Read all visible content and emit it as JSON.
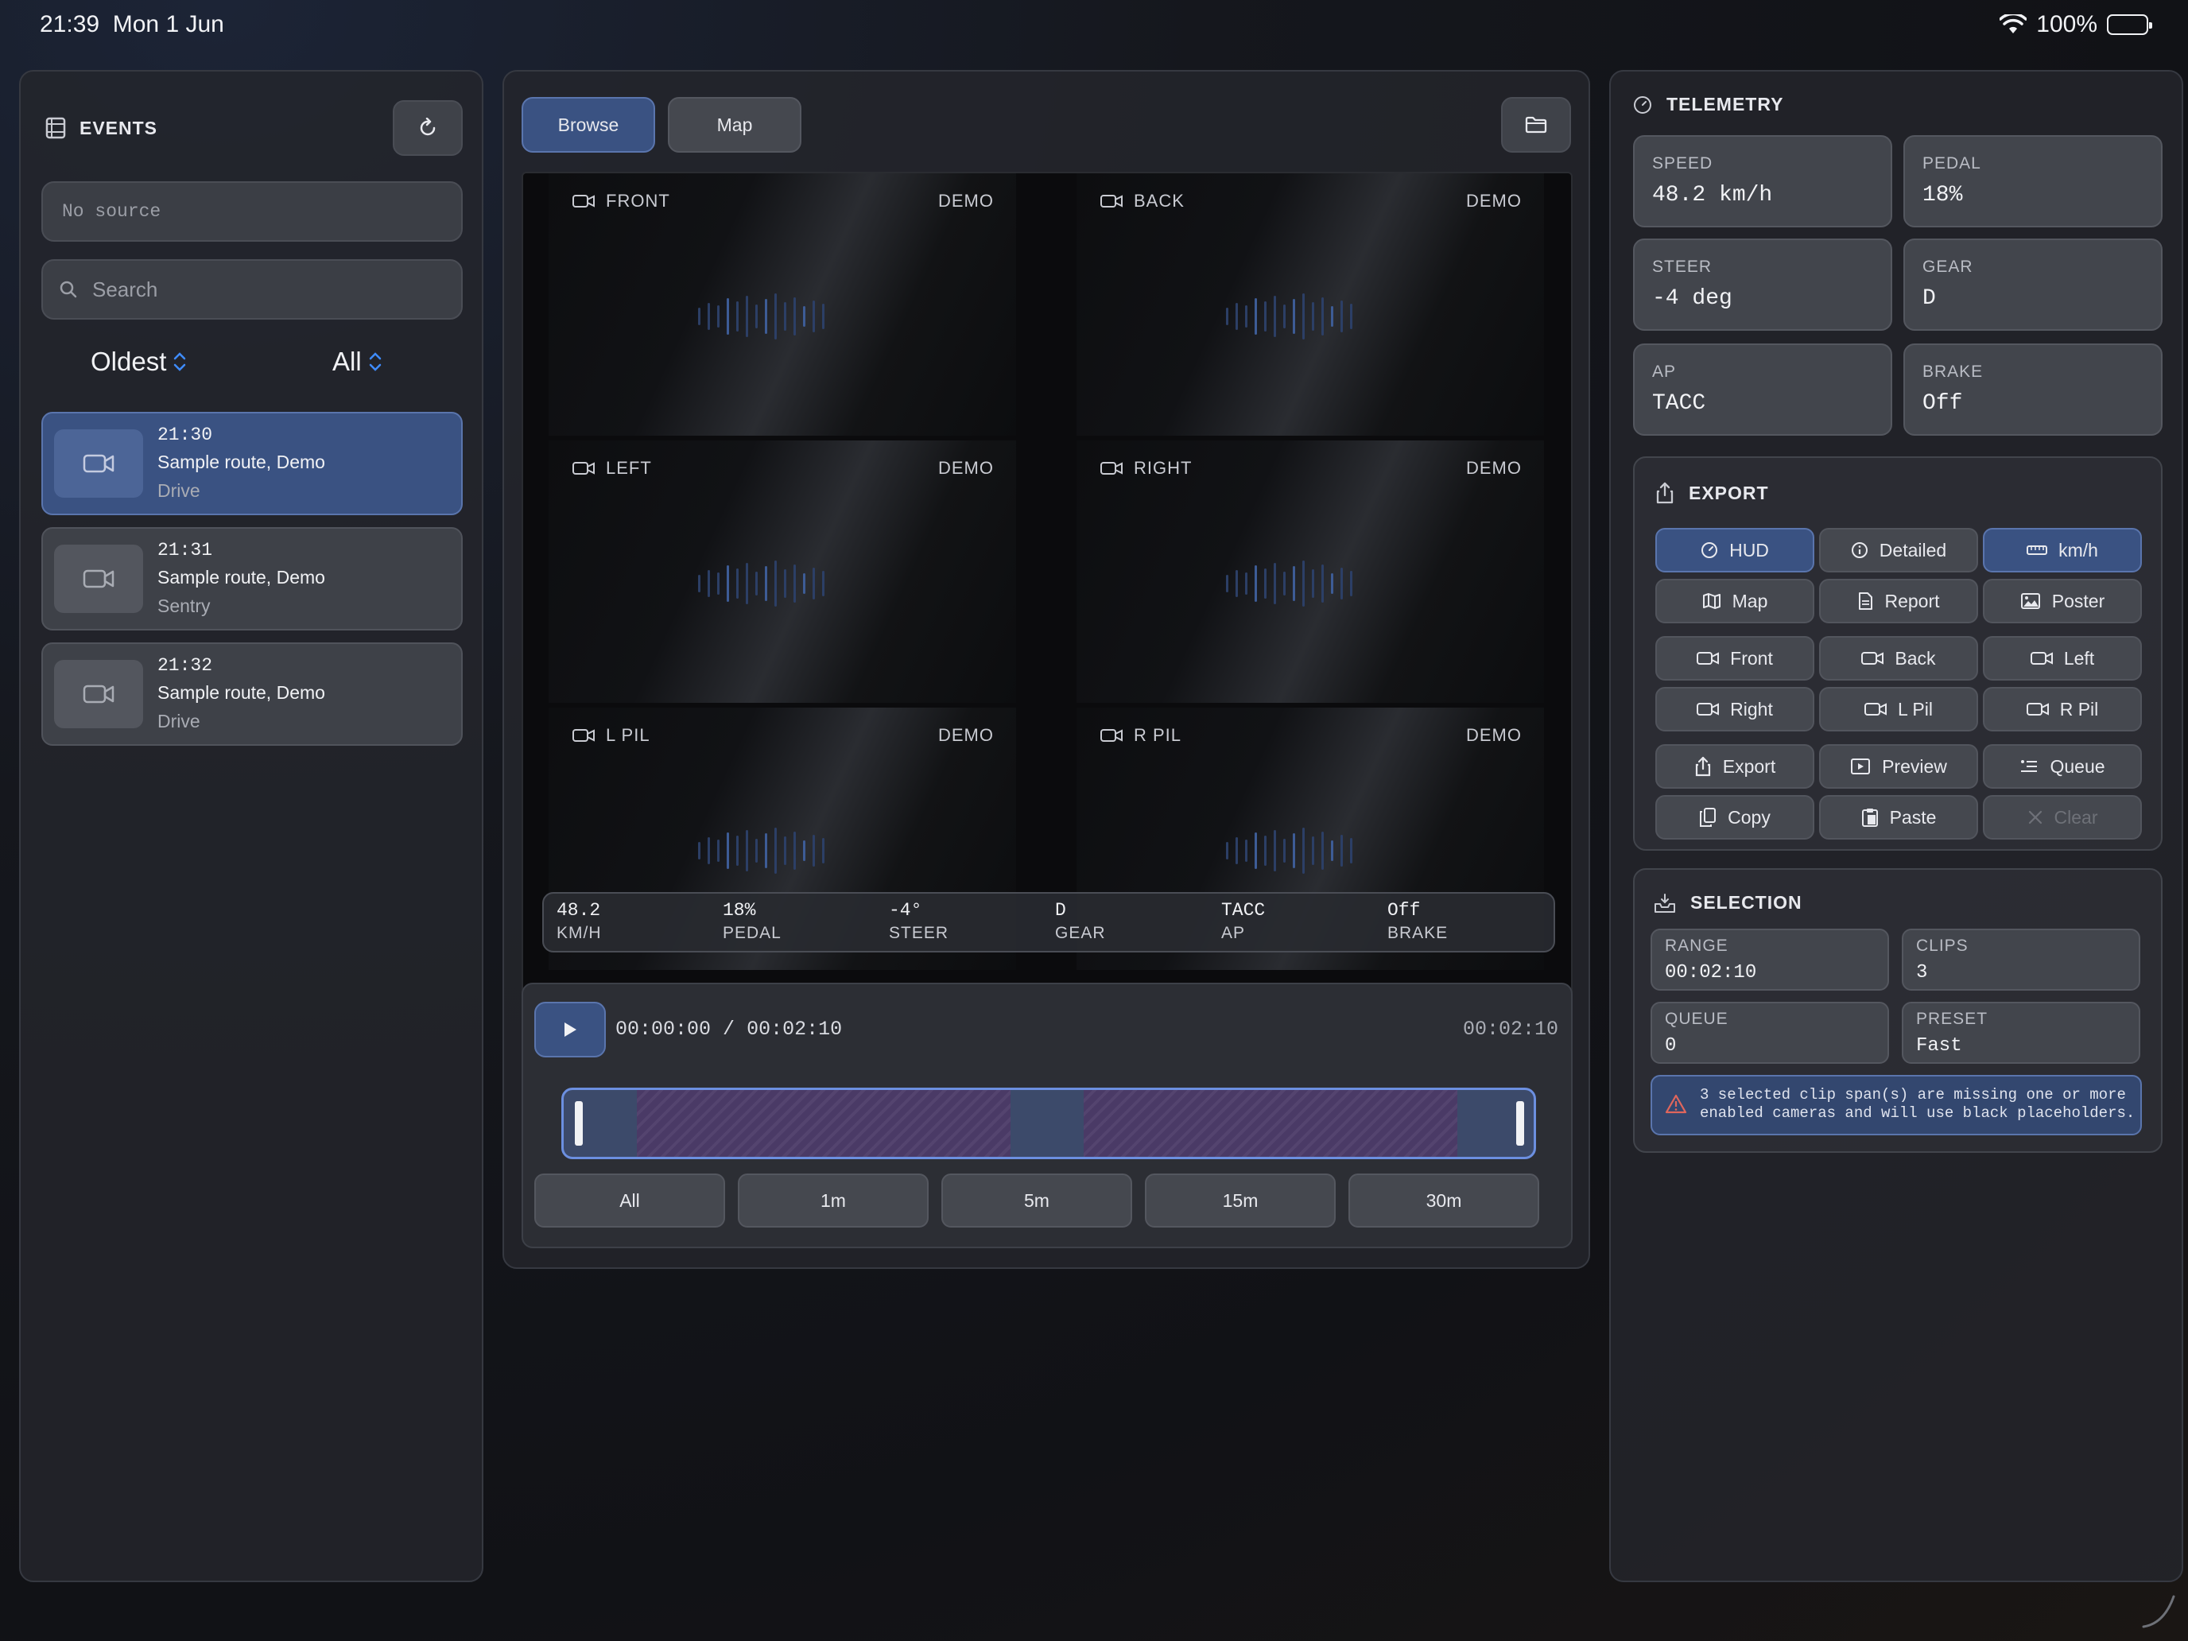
{
  "status_bar": {
    "time": "21:39",
    "date": "Mon 1 Jun",
    "battery": "100%"
  },
  "events": {
    "title": "EVENTS",
    "source_placeholder": "No source",
    "search_placeholder": "Search",
    "sort_order": "Oldest",
    "filter": "All",
    "items": [
      {
        "time": "21:30",
        "title": "Sample route, Demo",
        "type": "Drive",
        "selected": true
      },
      {
        "time": "21:31",
        "title": "Sample route, Demo",
        "type": "Sentry",
        "selected": false
      },
      {
        "time": "21:32",
        "title": "Sample route, Demo",
        "type": "Drive",
        "selected": false
      }
    ]
  },
  "viewer": {
    "tabs": [
      {
        "label": "Browse",
        "active": true
      },
      {
        "label": "Map",
        "active": false
      }
    ],
    "cameras": [
      {
        "name": "FRONT",
        "tag": "DEMO"
      },
      {
        "name": "BACK",
        "tag": "DEMO"
      },
      {
        "name": "LEFT",
        "tag": "DEMO"
      },
      {
        "name": "RIGHT",
        "tag": "DEMO"
      },
      {
        "name": "L PIL",
        "tag": "DEMO"
      },
      {
        "name": "R PIL",
        "tag": "DEMO"
      }
    ],
    "hud": [
      {
        "value": "48.2",
        "label": "KM/H"
      },
      {
        "value": "18%",
        "label": "PEDAL"
      },
      {
        "value": "-4°",
        "label": "STEER"
      },
      {
        "value": "D",
        "label": "GEAR"
      },
      {
        "value": "TACC",
        "label": "AP"
      },
      {
        "value": "Off",
        "label": "BRAKE"
      }
    ]
  },
  "player": {
    "current": "00:00:00",
    "separator": "/",
    "total": "00:02:10",
    "right_time": "00:02:10",
    "ranges": [
      "All",
      "1m",
      "5m",
      "15m",
      "30m"
    ]
  },
  "telemetry": {
    "title": "TELEMETRY",
    "tiles": [
      {
        "label": "SPEED",
        "value": "48.2 km/h"
      },
      {
        "label": "PEDAL",
        "value": "18%"
      },
      {
        "label": "STEER",
        "value": "-4 deg"
      },
      {
        "label": "GEAR",
        "value": "D"
      },
      {
        "label": "AP",
        "value": "TACC"
      },
      {
        "label": "BRAKE",
        "value": "Off"
      }
    ]
  },
  "export": {
    "title": "EXPORT",
    "row1": [
      "HUD",
      "Detailed",
      "km/h"
    ],
    "row2": [
      "Map",
      "Report",
      "Poster"
    ],
    "cams1": [
      "Front",
      "Back",
      "Left"
    ],
    "cams2": [
      "Right",
      "L Pil",
      "R Pil"
    ],
    "actions1": [
      "Export",
      "Preview",
      "Queue"
    ],
    "actions2": [
      "Copy",
      "Paste",
      "Clear"
    ]
  },
  "selection": {
    "title": "SELECTION",
    "tiles": [
      {
        "label": "RANGE",
        "value": "00:02:10"
      },
      {
        "label": "CLIPS",
        "value": "3"
      },
      {
        "label": "QUEUE",
        "value": "0"
      },
      {
        "label": "PRESET",
        "value": "Fast"
      }
    ],
    "warning": "3 selected clip span(s) are missing one or more enabled cameras and will use black placeholders."
  },
  "colors": {
    "accent": "#3a5282",
    "accent_border": "#5a75ad",
    "timeline_border": "#6c8fe0",
    "warning_icon": "#e0665c"
  }
}
